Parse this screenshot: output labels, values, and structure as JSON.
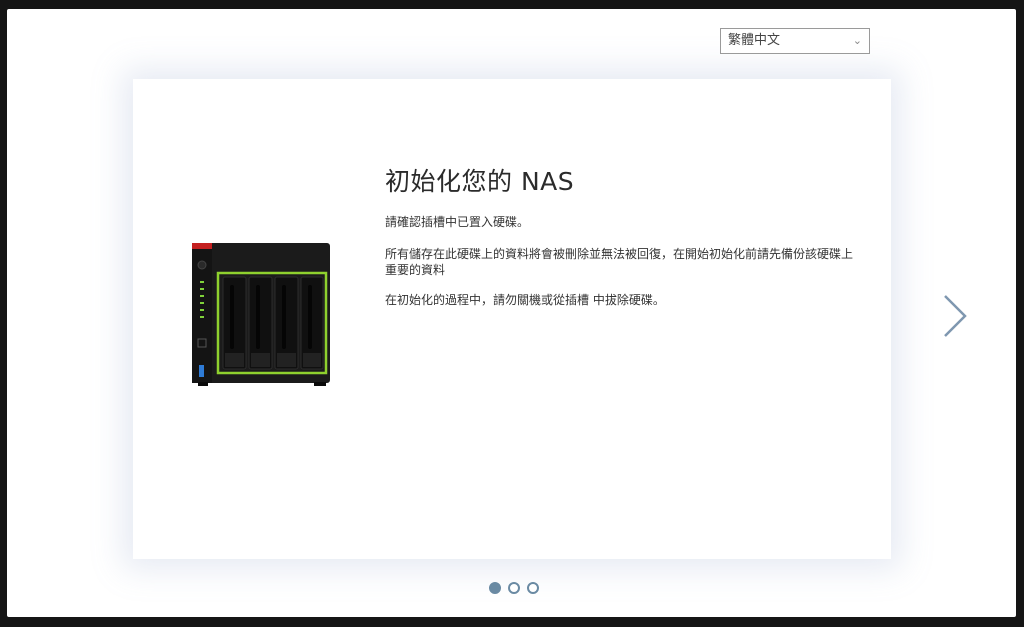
{
  "language_select": {
    "value": "繁體中文",
    "chevron_icon": "chevron-down-icon"
  },
  "title": "初始化您的 NAS",
  "paragraphs": [
    "請確認插槽中已置入硬碟。",
    "所有儲存在此硬碟上的資料將會被刪除並無法被回復，在開始初始化前請先備份該硬碟上重要的資料",
    "在初始化的過程中，請勿關機或從插槽 中拔除硬碟。"
  ],
  "next_icon": "chevron-right-icon",
  "pagination": {
    "total": 3,
    "current": 1
  },
  "device_image": "nas-device-4-bay",
  "colors": {
    "accent": "#6a8aa3",
    "drive_highlight": "#8fd12e"
  }
}
